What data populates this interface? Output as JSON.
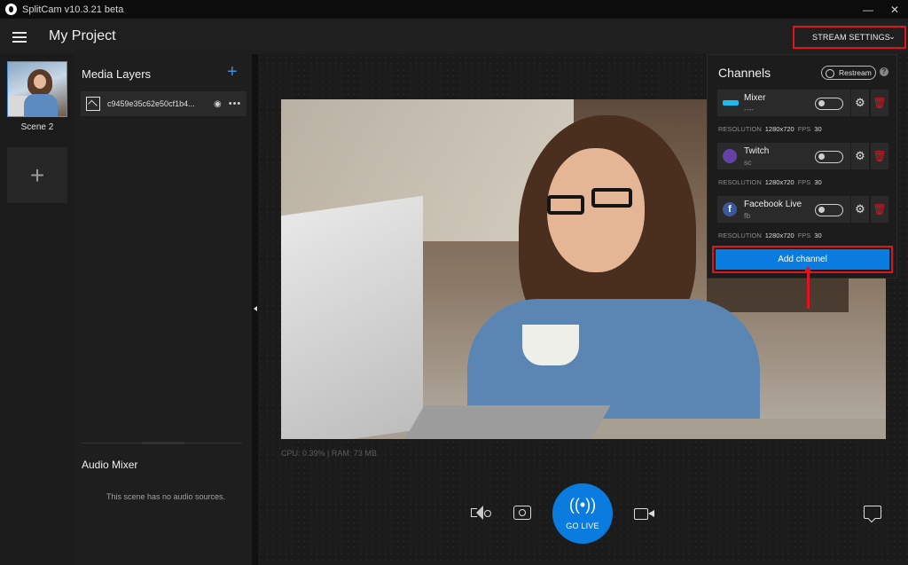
{
  "window": {
    "title": "SplitCam v10.3.21 beta",
    "minimize": "—",
    "close": "✕"
  },
  "header": {
    "project_title": "My Project",
    "stream_settings_label": "STREAM SETTINGS",
    "stream_settings_chevron": "⌄"
  },
  "scenes": {
    "items": [
      {
        "label": "Scene 2"
      }
    ],
    "add_label": "+"
  },
  "media_layers": {
    "title": "Media Layers",
    "add_label": "+",
    "items": [
      {
        "name": "c9459e35c62e50cf1b4...",
        "visibility_icon": "eye-icon",
        "more_label": "•••"
      }
    ]
  },
  "audio_mixer": {
    "title": "Audio Mixer",
    "empty_text": "This scene has no audio sources."
  },
  "preview": {
    "stats": "CPU: 0.39% | RAM: 73 MB"
  },
  "controls": {
    "go_live_label": "GO LIVE",
    "go_live_icon": "((•))"
  },
  "channels_panel": {
    "title": "Channels",
    "restream_label": "Restream",
    "help_label": "?",
    "resolution_label": "RESOLUTION",
    "fps_label": "FPS",
    "items": [
      {
        "name": "Mixer",
        "sub": "----",
        "logo": "mixer-logo",
        "resolution": "1280x720",
        "fps": "30",
        "logo_color": "#1fbaed"
      },
      {
        "name": "Twitch",
        "sub": "sc",
        "logo": "twitch-logo",
        "resolution": "1280x720",
        "fps": "30",
        "logo_color": "#6441a5"
      },
      {
        "name": "Facebook Live",
        "sub": "fb",
        "logo": "facebook-logo",
        "resolution": "1280x720",
        "fps": "30",
        "logo_color": "#3b5998"
      }
    ],
    "add_channel_label": "Add channel"
  },
  "colors": {
    "accent": "#0a7bdf",
    "highlight": "#e0141e",
    "delete": "#e0141e"
  }
}
